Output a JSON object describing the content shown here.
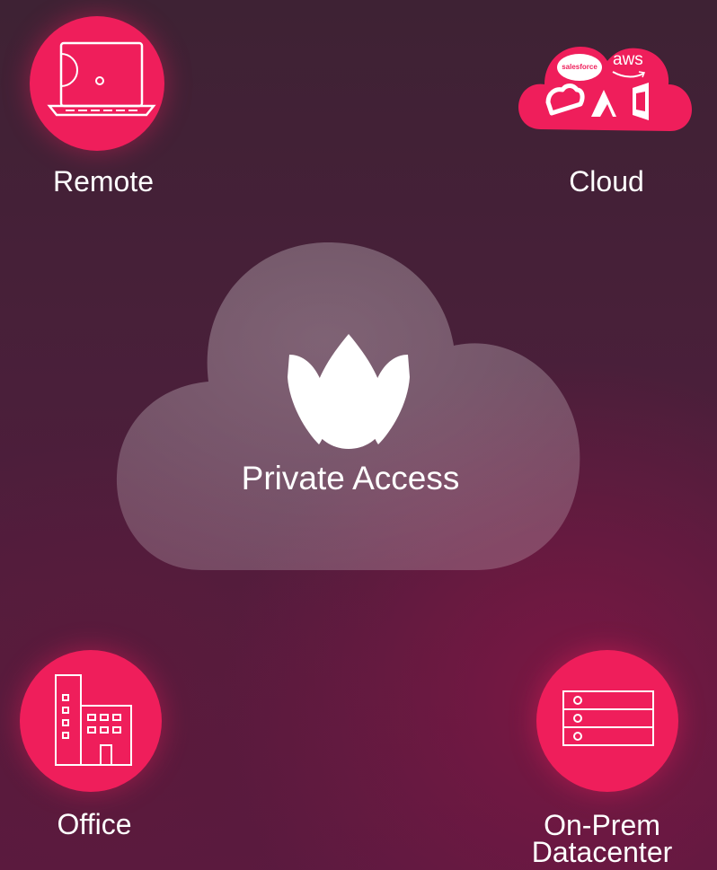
{
  "diagram": {
    "center": {
      "title": "Private Access",
      "icon": "lotus-logo-icon"
    },
    "nodes": [
      {
        "id": "remote",
        "label": "Remote",
        "icon": "laptop-icon"
      },
      {
        "id": "cloud",
        "label": "Cloud",
        "icon": "cloud-services-icon",
        "brands": [
          "salesforce",
          "aws"
        ]
      },
      {
        "id": "office",
        "label": "Office",
        "icon": "office-building-icon"
      },
      {
        "id": "datacenter",
        "label_line1": "On-Prem",
        "label_line2": "Datacenter",
        "icon": "server-rack-icon"
      }
    ],
    "colors": {
      "accent": "#ef1e5b",
      "background": "#4a1f3a",
      "text": "#ffffff"
    }
  }
}
